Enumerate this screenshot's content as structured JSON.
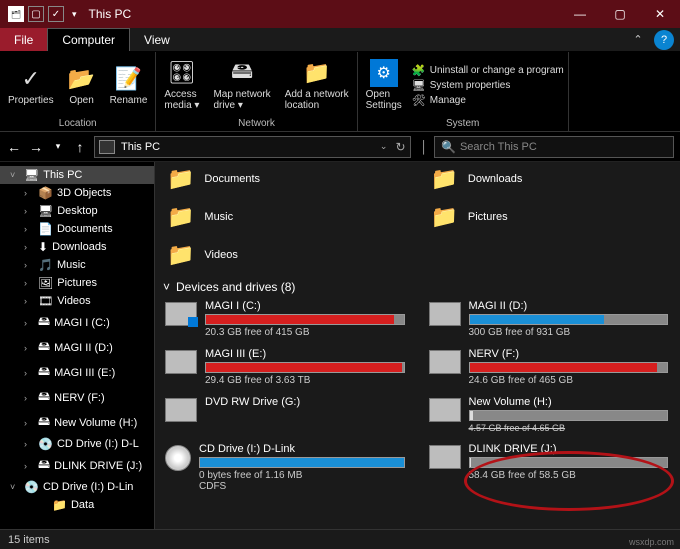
{
  "titlebar": {
    "title": "This PC"
  },
  "menu": {
    "file": "File",
    "computer": "Computer",
    "view": "View"
  },
  "ribbon": {
    "location": {
      "properties": "Properties",
      "open": "Open",
      "rename": "Rename",
      "label": "Location"
    },
    "network": {
      "access": "Access\nmedia ▾",
      "map": "Map network\ndrive ▾",
      "add": "Add a network\nlocation",
      "label": "Network"
    },
    "system": {
      "open": "Open\nSettings",
      "uninstall": "Uninstall or change a program",
      "sysprops": "System properties",
      "manage": "Manage",
      "label": "System"
    }
  },
  "address": {
    "path": "This PC"
  },
  "search": {
    "placeholder": "Search This PC"
  },
  "sidebar": [
    {
      "ex": "v",
      "icon": "🖥",
      "text": "This PC",
      "cls": "sel",
      "lvl": 0
    },
    {
      "ex": ">",
      "icon": "📦",
      "text": "3D Objects",
      "lvl": 1
    },
    {
      "ex": ">",
      "icon": "🖥",
      "text": "Desktop",
      "lvl": 1
    },
    {
      "ex": ">",
      "icon": "📄",
      "text": "Documents",
      "lvl": 1
    },
    {
      "ex": ">",
      "icon": "⬇",
      "text": "Downloads",
      "lvl": 1
    },
    {
      "ex": ">",
      "icon": "🎵",
      "text": "Music",
      "lvl": 1
    },
    {
      "ex": ">",
      "icon": "🖼",
      "text": "Pictures",
      "lvl": 1
    },
    {
      "ex": ">",
      "icon": "🎞",
      "text": "Videos",
      "lvl": 1
    },
    {
      "ex": ">",
      "icon": "🖴",
      "text": "MAGI I (C:)",
      "lvl": 1
    },
    {
      "ex": ">",
      "icon": "🖴",
      "text": "MAGI II (D:)",
      "lvl": 1
    },
    {
      "ex": ">",
      "icon": "🖴",
      "text": "MAGI III (E:)",
      "lvl": 1
    },
    {
      "ex": ">",
      "icon": "🖴",
      "text": "NERV (F:)",
      "lvl": 1
    },
    {
      "ex": ">",
      "icon": "🖴",
      "text": "New Volume (H:)",
      "lvl": 1
    },
    {
      "ex": ">",
      "icon": "💿",
      "text": "CD Drive (I:) D-L",
      "lvl": 1
    },
    {
      "ex": ">",
      "icon": "🖴",
      "text": "DLINK DRIVE (J:)",
      "lvl": 1
    },
    {
      "ex": "v",
      "icon": "💿",
      "text": "CD Drive (I:) D-Lin",
      "lvl": 0
    },
    {
      "ex": "",
      "icon": "📁",
      "text": "Data",
      "lvl": 2
    }
  ],
  "folders": [
    {
      "icon": "📁",
      "name": "Documents"
    },
    {
      "icon": "📁",
      "name": "Downloads"
    },
    {
      "icon": "📁",
      "name": "Music"
    },
    {
      "icon": "📁",
      "name": "Pictures"
    },
    {
      "icon": "📁",
      "name": "Videos"
    }
  ],
  "section": {
    "devices": "Devices and drives (8)"
  },
  "drives": [
    {
      "name": "MAGI I (C:)",
      "free": "20.3 GB free of 415 GB",
      "fill": 95,
      "color": "red",
      "win": true
    },
    {
      "name": "MAGI II (D:)",
      "free": "300 GB free of 931 GB",
      "fill": 68,
      "color": "blue"
    },
    {
      "name": "MAGI III (E:)",
      "free": "29.4 GB free of 3.63 TB",
      "fill": 99,
      "color": "red"
    },
    {
      "name": "NERV (F:)",
      "free": "24.6 GB free of 465 GB",
      "fill": 95,
      "color": "red"
    },
    {
      "name": "DVD RW Drive (G:)",
      "free": "",
      "nobar": true
    },
    {
      "name": "New Volume (H:)",
      "free": "4.57 GB free of 4.65 GB",
      "fill": 2,
      "color": "gray",
      "strike": true
    },
    {
      "name": "CD Drive (I:) D-Link",
      "free": "0 bytes free of 1.16 MB\nCDFS",
      "fill": 100,
      "color": "blue",
      "disc": true
    },
    {
      "name": "DLINK DRIVE (J:)",
      "free": "58.4 GB free of 58.5 GB",
      "fill": 1,
      "color": "gray"
    }
  ],
  "status": {
    "items": "15 items"
  },
  "watermark": "wsxdp.com"
}
